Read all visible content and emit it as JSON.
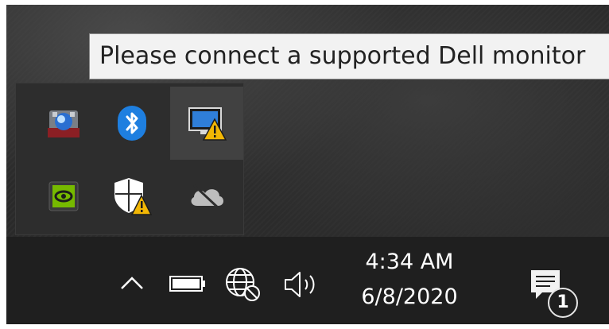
{
  "tooltip": {
    "text": "Please connect a supported Dell monitor"
  },
  "tray_flyout": {
    "icons": [
      {
        "name": "dell-display-manager-icon",
        "row": 1,
        "col": 1
      },
      {
        "name": "bluetooth-icon",
        "row": 1,
        "col": 2
      },
      {
        "name": "dell-monitor-warning-icon",
        "row": 1,
        "col": 3,
        "hovered": true
      },
      {
        "name": "nvidia-icon",
        "row": 2,
        "col": 1
      },
      {
        "name": "windows-security-warning-icon",
        "row": 2,
        "col": 2
      },
      {
        "name": "onedrive-offline-icon",
        "row": 2,
        "col": 3
      }
    ]
  },
  "taskbar": {
    "icons": [
      "show-hidden-icons-chevron",
      "battery-icon",
      "network-icon",
      "volume-icon"
    ],
    "clock": {
      "time": "4:34 AM",
      "date": "6/8/2020"
    },
    "notifications": {
      "count": "1"
    }
  },
  "colors": {
    "taskbar": "#1f1f1f",
    "flyout": "#2d2d2d",
    "bluetooth": "#1e7fe0",
    "nvidia": "#76b900",
    "warning": "#f2b705"
  }
}
